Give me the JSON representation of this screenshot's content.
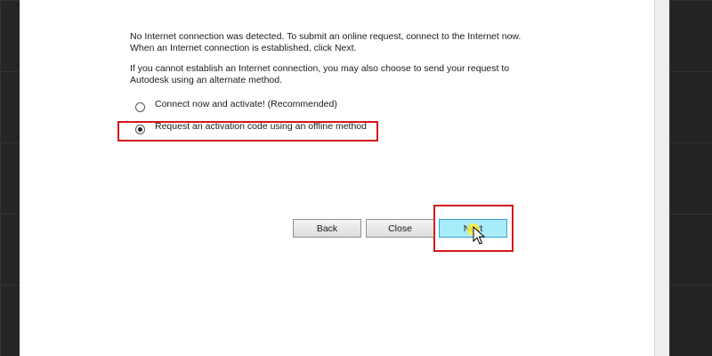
{
  "message": {
    "line1": "No Internet connection was detected. To submit an online request, connect to the Internet now.",
    "line2": "When an Internet connection is established, click Next.",
    "line3": "If you cannot establish an Internet connection, you may also choose to send your request to",
    "line4": "Autodesk using an alternate method."
  },
  "options": [
    {
      "label": "Connect now and activate! (Recommended)",
      "selected": false
    },
    {
      "label": "Request an activation code using an offline method",
      "selected": true
    }
  ],
  "buttons": {
    "back": "Back",
    "close": "Close",
    "next": "Next"
  },
  "colors": {
    "highlight": "#d11a1a",
    "next_button": "#a8ecfb"
  }
}
